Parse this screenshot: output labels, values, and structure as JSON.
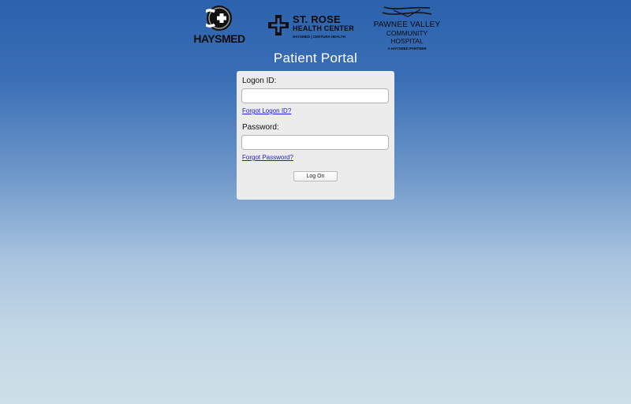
{
  "logos": {
    "haysmed": {
      "wordmark": "HAYSMED",
      "icon": "haysmed-cross-emblem"
    },
    "st_rose": {
      "line1": "ST. ROSE",
      "line2": "HEALTH CENTER",
      "line3": "HAYSMED | CENTURA HEALTH",
      "icon": "st-rose-cross-emblem"
    },
    "pawnee": {
      "line1": "PAWNEE VALLEY",
      "line2": "COMMUNITY HOSPITAL",
      "line3": "A HAYSMED PARTNER",
      "icon": "pawnee-valley-swoosh"
    }
  },
  "portal": {
    "title": "Patient Portal"
  },
  "login": {
    "logon_id_label": "Logon ID:",
    "logon_id_value": "",
    "forgot_logon_link": "Forgot Logon ID?",
    "password_label": "Password:",
    "password_value": "",
    "forgot_password_link": "Forgot Password?",
    "logon_button": "Log On"
  },
  "colors": {
    "background_top": "#2c62ad",
    "background_bottom": "#cde0e9",
    "panel": "#ececec",
    "link": "#1a1ae6",
    "title_text": "#ffffff"
  }
}
